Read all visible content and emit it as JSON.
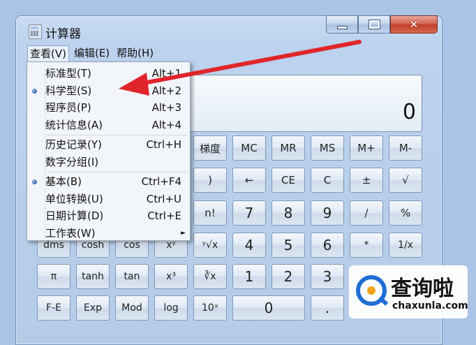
{
  "window": {
    "title": "计算器"
  },
  "menubar": {
    "items": [
      "查看(V)",
      "编辑(E)",
      "帮助(H)"
    ],
    "active_index": 0
  },
  "display": {
    "value": "0"
  },
  "dropdown": {
    "groups": [
      [
        {
          "label": "标准型(T)",
          "shortcut": "Alt+1",
          "selected": false
        },
        {
          "label": "科学型(S)",
          "shortcut": "Alt+2",
          "selected": true
        },
        {
          "label": "程序员(P)",
          "shortcut": "Alt+3",
          "selected": false
        },
        {
          "label": "统计信息(A)",
          "shortcut": "Alt+4",
          "selected": false
        }
      ],
      [
        {
          "label": "历史记录(Y)",
          "shortcut": "Ctrl+H",
          "selected": false
        },
        {
          "label": "数字分组(I)",
          "shortcut": "",
          "selected": false
        }
      ],
      [
        {
          "label": "基本(B)",
          "shortcut": "Ctrl+F4",
          "selected": true
        },
        {
          "label": "单位转换(U)",
          "shortcut": "Ctrl+U",
          "selected": false
        },
        {
          "label": "日期计算(D)",
          "shortcut": "Ctrl+E",
          "selected": false
        },
        {
          "label": "工作表(W)",
          "shortcut": "",
          "selected": false,
          "submenu": true
        }
      ]
    ]
  },
  "keys": {
    "row1": [
      "梯度",
      "MC",
      "MR",
      "MS",
      "M+",
      "M-"
    ],
    "row2": [
      ")",
      "←",
      "CE",
      "C",
      "±",
      "√"
    ],
    "row3": [
      "n!",
      "7",
      "8",
      "9",
      "/",
      "%"
    ],
    "row4": [
      "dms",
      "cosh",
      "cos",
      "xʸ",
      "ʸ√x",
      "4",
      "5",
      "6",
      "*",
      "1/x"
    ],
    "row5": [
      "π",
      "tanh",
      "tan",
      "x³",
      "∛x",
      "1",
      "2",
      "3"
    ],
    "row6": [
      "F-E",
      "Exp",
      "Mod",
      "log",
      "10ˣ",
      "0",
      "."
    ]
  },
  "watermark": {
    "title": "查询啦",
    "subtitle": "chaxunla.com"
  },
  "colors": {
    "arrow": "#e0262b",
    "accent": "#1f6ed6"
  }
}
